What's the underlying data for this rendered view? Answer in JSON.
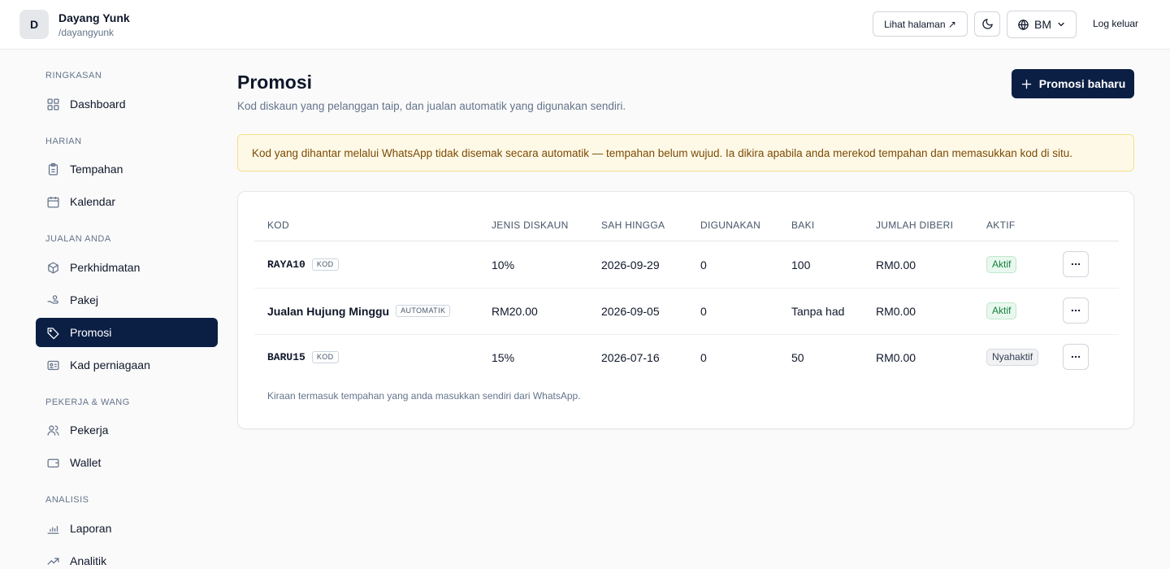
{
  "header": {
    "avatar_letter": "D",
    "name": "Dayang Yunk",
    "handle": "/dayangyunk",
    "view_page": "Lihat halaman ↗",
    "language": "BM",
    "logout": "Log keluar"
  },
  "sidebar": {
    "sections": [
      {
        "label": "RINGKASAN",
        "items": [
          {
            "label": "Dashboard",
            "icon": "grid-icon"
          }
        ]
      },
      {
        "label": "HARIAN",
        "items": [
          {
            "label": "Tempahan",
            "icon": "clipboard-icon"
          },
          {
            "label": "Kalendar",
            "icon": "calendar-icon"
          }
        ]
      },
      {
        "label": "JUALAN ANDA",
        "items": [
          {
            "label": "Perkhidmatan",
            "icon": "box-icon"
          },
          {
            "label": "Pakej",
            "icon": "hand-coins-icon"
          },
          {
            "label": "Promosi",
            "icon": "tag-icon",
            "active": true
          },
          {
            "label": "Kad perniagaan",
            "icon": "id-card-icon"
          }
        ]
      },
      {
        "label": "PEKERJA & WANG",
        "items": [
          {
            "label": "Pekerja",
            "icon": "users-icon"
          },
          {
            "label": "Wallet",
            "icon": "wallet-icon"
          }
        ]
      },
      {
        "label": "ANALISIS",
        "items": [
          {
            "label": "Laporan",
            "icon": "bar-chart-icon"
          },
          {
            "label": "Analitik",
            "icon": "trend-up-icon"
          }
        ]
      }
    ]
  },
  "main": {
    "title": "Promosi",
    "subtitle": "Kod diskaun yang pelanggan taip, dan jualan automatik yang digunakan sendiri.",
    "new_button": "Promosi baharu",
    "alert": "Kod yang dihantar melalui WhatsApp tidak disemak secara automatik — tempahan belum wujud. Ia dikira apabila anda merekod tempahan dan memasukkan kod di situ.",
    "table": {
      "columns": [
        "KOD",
        "JENIS DISKAUN",
        "SAH HINGGA",
        "DIGUNAKAN",
        "BAKI",
        "JUMLAH DIBERI",
        "AKTIF"
      ],
      "rows": [
        {
          "code": "RAYA10",
          "code_style": "mono",
          "tag": "KOD",
          "discount": "10%",
          "valid_until": "2026-09-29",
          "used": "0",
          "remaining": "100",
          "total_given": "RM0.00",
          "status": "Aktif",
          "active": true
        },
        {
          "code": "Jualan Hujung Minggu",
          "code_style": "bold",
          "tag": "AUTOMATIK",
          "discount": "RM20.00",
          "valid_until": "2026-09-05",
          "used": "0",
          "remaining": "Tanpa had",
          "total_given": "RM0.00",
          "status": "Aktif",
          "active": true
        },
        {
          "code": "BARU15",
          "code_style": "mono",
          "tag": "KOD",
          "discount": "15%",
          "valid_until": "2026-07-16",
          "used": "0",
          "remaining": "50",
          "total_given": "RM0.00",
          "status": "Nyahaktif",
          "active": false
        }
      ],
      "footnote": "Kiraan termasuk tempahan yang anda masukkan sendiri dari WhatsApp."
    }
  },
  "colors": {
    "primary": "#0b1f44",
    "alert_bg": "#fef9e7",
    "active_badge": "#15803d"
  }
}
